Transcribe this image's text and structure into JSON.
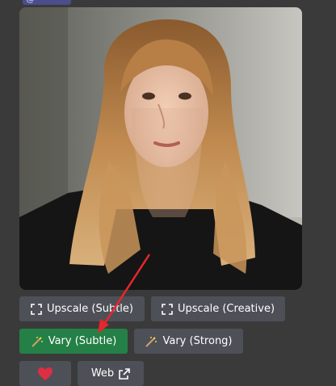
{
  "mention": {
    "text": "@"
  },
  "image": {
    "alt": "generated portrait"
  },
  "buttons": {
    "upscale_subtle": "Upscale (Subtle)",
    "upscale_creative": "Upscale (Creative)",
    "vary_subtle": "Vary (Subtle)",
    "vary_strong": "Vary (Strong)",
    "web": "Web"
  },
  "icons": {
    "upscale": "expand-icon",
    "vary": "magic-wand-icon",
    "favorite": "heart-icon",
    "external": "external-link-icon"
  },
  "colors": {
    "background": "#3a3a3b",
    "button_grey": "#4e5058",
    "button_green": "#248046",
    "heart": "#dd2e44",
    "annotation_arrow": "#e8262b"
  }
}
